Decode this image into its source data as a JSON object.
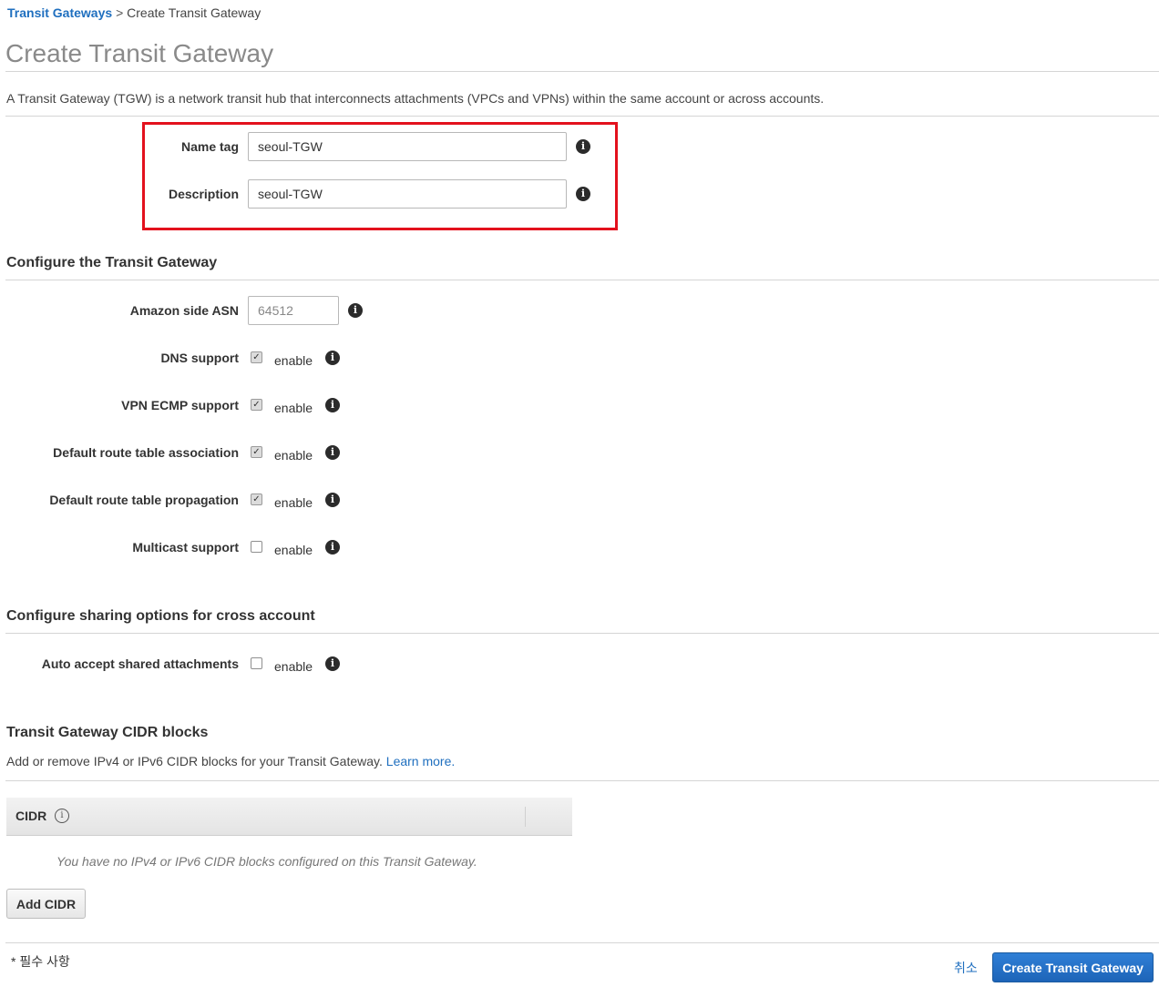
{
  "breadcrumb": {
    "parent": "Transit Gateways",
    "separator": ">",
    "current": "Create Transit Gateway"
  },
  "page": {
    "title": "Create Transit Gateway",
    "intro": "A Transit Gateway (TGW) is a network transit hub that interconnects attachments (VPCs and VPNs) within the same account or across accounts."
  },
  "details": {
    "name_tag_label": "Name tag",
    "name_tag_value": "seoul-TGW",
    "description_label": "Description",
    "description_value": "seoul-TGW"
  },
  "configure": {
    "title": "Configure the Transit Gateway",
    "asn_label": "Amazon side ASN",
    "asn_placeholder": "64512",
    "checkbox_text": "enable",
    "options": [
      {
        "label": "DNS support",
        "checked": true
      },
      {
        "label": "VPN ECMP support",
        "checked": true
      },
      {
        "label": "Default route table association",
        "checked": true
      },
      {
        "label": "Default route table propagation",
        "checked": true
      },
      {
        "label": "Multicast support",
        "checked": false
      }
    ]
  },
  "sharing": {
    "title": "Configure sharing options for cross account",
    "auto_accept_label": "Auto accept shared attachments",
    "auto_accept_checked": false,
    "checkbox_text": "enable"
  },
  "cidr": {
    "title": "Transit Gateway CIDR blocks",
    "subtitle": "Add or remove IPv4 or IPv6 CIDR blocks for your Transit Gateway.",
    "learn_more": "Learn more",
    "learn_more_suffix": ".",
    "column_header": "CIDR",
    "empty_message": "You have no IPv4 or IPv6 CIDR blocks configured on this Transit Gateway.",
    "add_button": "Add CIDR"
  },
  "footer": {
    "required_note": "* 필수 사항",
    "cancel_label": "취소",
    "submit_label": "Create Transit Gateway"
  },
  "icons": {
    "info": "i",
    "check": "✓"
  },
  "colors": {
    "link": "#1f6fbf",
    "highlight_border": "#e3111d",
    "primary_button": "#1d64b8"
  }
}
